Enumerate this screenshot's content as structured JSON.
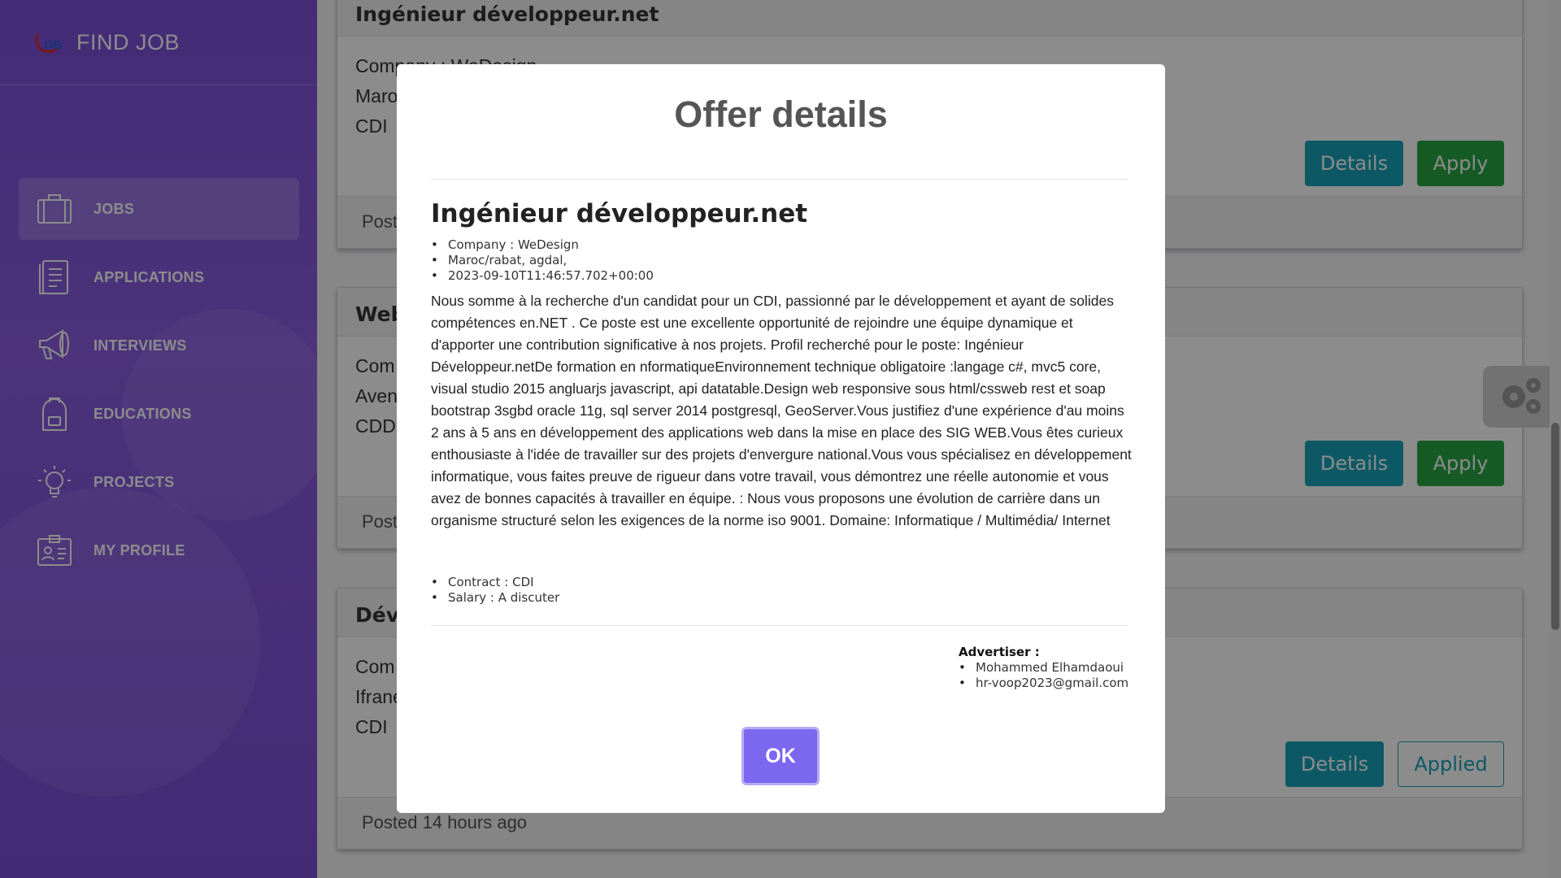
{
  "app": {
    "name": "FIND JOB",
    "accent_color": "#7b4fd8"
  },
  "sidebar": {
    "items": [
      {
        "label": "JOBS",
        "icon": "briefcase-icon",
        "active": true
      },
      {
        "label": "APPLICATIONS",
        "icon": "document-icon",
        "active": false
      },
      {
        "label": "INTERVIEWS",
        "icon": "megaphone-icon",
        "active": false
      },
      {
        "label": "EDUCATIONS",
        "icon": "backpack-icon",
        "active": false
      },
      {
        "label": "PROJECTS",
        "icon": "lightbulb-icon",
        "active": false
      },
      {
        "label": "MY PROFILE",
        "icon": "id-card-icon",
        "active": false
      }
    ]
  },
  "jobs": [
    {
      "title": "Ingénieur développeur.net",
      "company": "Company : WeDesign",
      "location": "Maroc",
      "contract": "CDI",
      "posted": "Post",
      "details_label": "Details",
      "action_label": "Apply"
    },
    {
      "title": "Web",
      "company": "Com",
      "location": "Aven",
      "contract": "CDD",
      "posted": "Post",
      "details_label": "Details",
      "action_label": "Apply"
    },
    {
      "title": "Dév",
      "company": "Com",
      "location": "Ifrane",
      "contract": "CDI",
      "posted": "Posted 14 hours ago",
      "details_label": "Details",
      "action_label": "Applied"
    }
  ],
  "modal": {
    "title": "Offer details",
    "offer_title": "Ingénieur développeur.net",
    "meta": [
      "Company : WeDesign",
      "Maroc/rabat, agdal,",
      "2023-09-10T11:46:57.702+00:00"
    ],
    "description": "Nous somme à la recherche d'un candidat pour un CDI, passionné par le développement et ayant de solides compétences en.NET . Ce poste est une excellente opportunité de rejoindre une équipe dynamique et d'apporter une contribution significative à nos projets. Profil recherché pour le poste: Ingénieur Développeur.netDe formation en nformatiqueEnvironnement technique obligatoire :langage c#, mvc5 core, visual studio 2015 angluarjs javascript, api datatable.Design web responsive sous html/cssweb rest et soap bootstrap 3sgbd oracle 11g, sql server 2014 postgresql, GeoServer.Vous justifiez d'une expérience d'au moins 2 ans à 5 ans en développement des applications web dans la mise en place des SIG WEB.Vous êtes curieux enthousiaste à l'idée de travailler sur des projets d'envergure national.Vous vous spécialisez en développement informatique, vous faites preuve de rigueur dans votre travail, vous démontrez une réelle autonomie et vous avez de bonnes capacités à travailler en équipe. : Nous vous proposons une évolution de carrière dans un organisme structuré selon les exigences de la norme iso 9001. Domaine: Informatique / Multimédia/ Internet",
    "terms": [
      "Contract : CDI",
      "Salary : A discuter"
    ],
    "advertiser_label": "Advertiser :",
    "advertiser": [
      "Mohammed Elhamdaoui",
      "hr-voop2023@gmail.com"
    ],
    "ok_label": "OK"
  }
}
